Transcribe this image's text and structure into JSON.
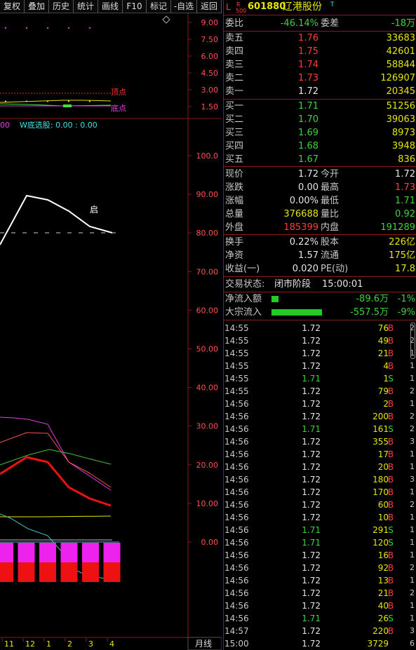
{
  "toolbar": [
    "复权",
    "叠加",
    "历史",
    "统计",
    "画线",
    "F10",
    "标记",
    "-自选",
    "返回"
  ],
  "stock": {
    "code": "601880",
    "name": "辽港股份",
    "flag_left": "L",
    "flag_r": "R",
    "flag_500": "500",
    "flag_t": "T"
  },
  "weibi": {
    "label": "委比",
    "value": "-46.14%",
    "label2": "委差",
    "value2": "-18万"
  },
  "asks": [
    {
      "label": "卖五",
      "price": "1.76",
      "vol": "33683"
    },
    {
      "label": "卖四",
      "price": "1.75",
      "vol": "42601"
    },
    {
      "label": "卖三",
      "price": "1.74",
      "vol": "58844"
    },
    {
      "label": "卖二",
      "price": "1.73",
      "vol": "126907"
    },
    {
      "label": "卖一",
      "price": "1.72",
      "vol": "20345"
    }
  ],
  "bids": [
    {
      "label": "买一",
      "price": "1.71",
      "vol": "51256"
    },
    {
      "label": "买二",
      "price": "1.70",
      "vol": "39063"
    },
    {
      "label": "买三",
      "price": "1.69",
      "vol": "8973"
    },
    {
      "label": "买四",
      "price": "1.68",
      "vol": "3948"
    },
    {
      "label": "买五",
      "price": "1.67",
      "vol": "836"
    }
  ],
  "quote": [
    {
      "l1": "现价",
      "v1": "1.72",
      "c1": "white",
      "l2": "今开",
      "v2": "1.72",
      "c2": "white"
    },
    {
      "l1": "涨跌",
      "v1": "0.00",
      "c1": "white",
      "l2": "最高",
      "v2": "1.73",
      "c2": "red"
    },
    {
      "l1": "涨幅",
      "v1": "0.00%",
      "c1": "white",
      "l2": "最低",
      "v2": "1.71",
      "c2": "green"
    },
    {
      "l1": "总量",
      "v1": "376688",
      "c1": "yellow",
      "l2": "量比",
      "v2": "0.92",
      "c2": "green"
    },
    {
      "l1": "外盘",
      "v1": "185399",
      "c1": "red",
      "l2": "内盘",
      "v2": "191289",
      "c2": "green"
    }
  ],
  "fund": [
    {
      "l1": "换手",
      "v1": "0.22%",
      "l2": "股本",
      "v2": "226亿"
    },
    {
      "l1": "净资",
      "v1": "1.57",
      "l2": "流通",
      "v2": "175亿"
    },
    {
      "l1": "收益(一)",
      "v1": "0.020",
      "l2": "PE(动)",
      "v2": "17.8"
    }
  ],
  "status": {
    "label": "交易状态:",
    "value": "闭市阶段",
    "time": "15:00:01"
  },
  "flows": [
    {
      "label": "净流入额",
      "value": "-89.6万",
      "pct": "-1%",
      "bar": 0.08
    },
    {
      "label": "大宗流入",
      "value": "-557.5万",
      "pct": "-9%",
      "bar": 0.72
    }
  ],
  "ticks": [
    {
      "t": "14:55",
      "p": "1.72",
      "v": "76",
      "s": "B",
      "n": "2"
    },
    {
      "t": "14:55",
      "p": "1.72",
      "v": "49",
      "s": "B",
      "n": "2"
    },
    {
      "t": "14:55",
      "p": "1.72",
      "v": "21",
      "s": "B",
      "n": "1"
    },
    {
      "t": "14:55",
      "p": "1.72",
      "v": "4",
      "s": "B",
      "n": "1"
    },
    {
      "t": "14:55",
      "p": "1.71",
      "v": "1",
      "s": "S",
      "n": "1"
    },
    {
      "t": "14:55",
      "p": "1.72",
      "v": "79",
      "s": "B",
      "n": "2"
    },
    {
      "t": "14:56",
      "p": "1.72",
      "v": "2",
      "s": "B",
      "n": "1"
    },
    {
      "t": "14:56",
      "p": "1.72",
      "v": "200",
      "s": "B",
      "n": "2"
    },
    {
      "t": "14:56",
      "p": "1.71",
      "v": "161",
      "s": "S",
      "n": "2"
    },
    {
      "t": "14:56",
      "p": "1.72",
      "v": "355",
      "s": "B",
      "n": "3"
    },
    {
      "t": "14:56",
      "p": "1.72",
      "v": "17",
      "s": "B",
      "n": "1"
    },
    {
      "t": "14:56",
      "p": "1.72",
      "v": "20",
      "s": "B",
      "n": "1"
    },
    {
      "t": "14:56",
      "p": "1.72",
      "v": "180",
      "s": "B",
      "n": "3"
    },
    {
      "t": "14:56",
      "p": "1.72",
      "v": "170",
      "s": "B",
      "n": "1"
    },
    {
      "t": "14:56",
      "p": "1.72",
      "v": "60",
      "s": "B",
      "n": "2"
    },
    {
      "t": "14:56",
      "p": "1.72",
      "v": "10",
      "s": "B",
      "n": "1"
    },
    {
      "t": "14:56",
      "p": "1.71",
      "v": "291",
      "s": "S",
      "n": "1"
    },
    {
      "t": "14:56",
      "p": "1.71",
      "v": "120",
      "s": "S",
      "n": "1"
    },
    {
      "t": "14:56",
      "p": "1.72",
      "v": "16",
      "s": "B",
      "n": "1"
    },
    {
      "t": "14:56",
      "p": "1.72",
      "v": "92",
      "s": "B",
      "n": "2"
    },
    {
      "t": "14:56",
      "p": "1.72",
      "v": "13",
      "s": "B",
      "n": "1"
    },
    {
      "t": "14:56",
      "p": "1.72",
      "v": "21",
      "s": "B",
      "n": "2"
    },
    {
      "t": "14:56",
      "p": "1.72",
      "v": "40",
      "s": "B",
      "n": "1"
    },
    {
      "t": "14:56",
      "p": "1.71",
      "v": "26",
      "s": "S",
      "n": "1"
    },
    {
      "t": "14:57",
      "p": "1.72",
      "v": "220",
      "s": "B",
      "n": "3"
    },
    {
      "t": "15:00",
      "p": "1.72",
      "v": "3729",
      "s": "",
      "n": "6"
    }
  ],
  "chart": {
    "top_axis": [
      "9.00",
      "7.50",
      "6.00",
      "4.50",
      "3.00",
      "1.50"
    ],
    "top_label_1": "顶点",
    "top_label_2": "底点",
    "indicator_text": "W底选股: 0.00 : 0.00",
    "indicator_prefix": "00",
    "mid_axis": [
      "100.0",
      "90.00",
      "80.00",
      "70.00",
      "60.00",
      "50.00",
      "40.00",
      "30.00",
      "20.00",
      "10.00",
      "0.00"
    ],
    "qi_label": "启",
    "months": [
      "11",
      "12",
      "1",
      "2",
      "3",
      "4"
    ],
    "period_label": "月线",
    "diamond_icon": "diamond-icon"
  }
}
